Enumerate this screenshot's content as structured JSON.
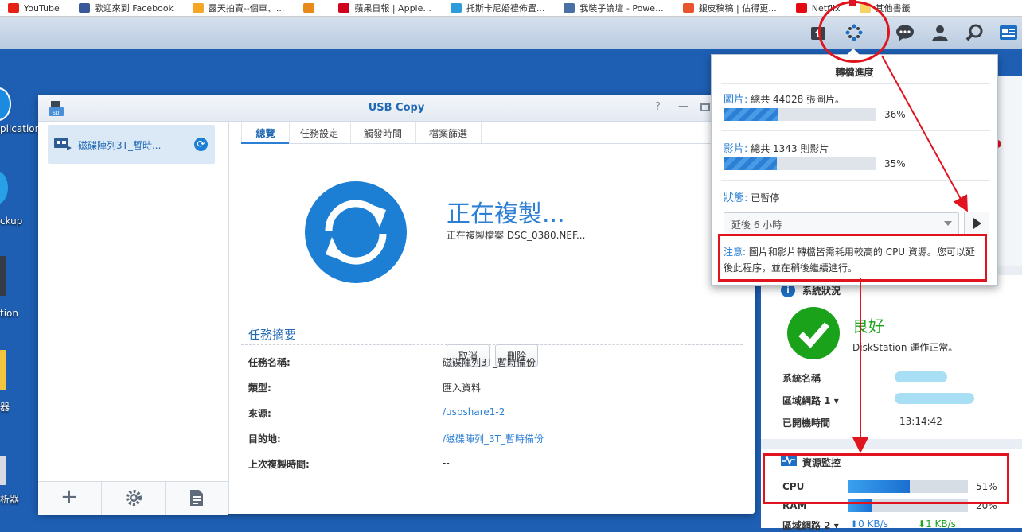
{
  "bookmarks": [
    {
      "label": "YouTube",
      "color": "#e62117"
    },
    {
      "label": "歡迎來到 Facebook",
      "color": "#3b5998"
    },
    {
      "label": "露天拍賣--個車、...",
      "color": "#f5a623"
    },
    {
      "label": "",
      "color": "#e88a1a"
    },
    {
      "label": "蘋果日報 | Apple...",
      "color": "#d0021b"
    },
    {
      "label": "托斯卡尼婚禮佈置...",
      "color": "#2d9cdb"
    },
    {
      "label": "我裝子論壇 - Powe...",
      "color": "#4a6fa5"
    },
    {
      "label": "銀皮稿稿 | 佔得更...",
      "color": "#e8542b"
    },
    {
      "label": "Netflix",
      "color": "#e50914"
    },
    {
      "label": "其他書籤",
      "color": "#f6d365"
    }
  ],
  "desktop": {
    "labels": [
      "plication",
      "ckup",
      "tion",
      "器",
      "析器"
    ]
  },
  "usb_window": {
    "title": "USB Copy",
    "help": "?",
    "minimize": "—",
    "task_item": "磁碟陣列3T_暫時...",
    "tabs": [
      "總覽",
      "任務設定",
      "觸發時間",
      "檔案篩選"
    ],
    "status_title": "正在複製...",
    "status_sub": "正在複製檔案 DSC_0380.NEF...",
    "cancel_label": "取消",
    "delete_label": "刪除",
    "summary_title": "任務摘要",
    "summary": [
      {
        "label": "任務名稱:",
        "value": "磁碟陣列3T_暫時備份",
        "link": false
      },
      {
        "label": "類型:",
        "value": "匯入資料",
        "link": false
      },
      {
        "label": "來源:",
        "value": "/usbshare1-2",
        "link": true
      },
      {
        "label": "目的地:",
        "value": "/磁碟陣列_3T_暫時備份",
        "link": true
      },
      {
        "label": "上次複製時間:",
        "value": "--",
        "link": false
      }
    ]
  },
  "popup": {
    "title": "轉檔進度",
    "photo_label": "圖片:",
    "photo_text": "總共 44028 張圖片。",
    "photo_percent": "36%",
    "photo_value": 0.36,
    "video_label": "影片:",
    "video_text": "總共 1343 則影片",
    "video_percent": "35%",
    "video_value": 0.35,
    "status_label": "狀態:",
    "status_value": "已暫停",
    "delay_select": "延後 6 小時",
    "note_label": "注意:",
    "note_text": "圖片和影片轉檔皆需耗用較高的 CPU 資源。您可以延後此程序，並在稍後繼續進行。"
  },
  "health": {
    "title": "系統狀況",
    "status": "良好",
    "desc": "DiskStation 運作正常。",
    "rows": [
      {
        "label": "系統名稱",
        "value": ""
      },
      {
        "label": "區域網路 1 ▾",
        "value": ""
      },
      {
        "label": "已開機時間",
        "value": "13:14:42"
      }
    ]
  },
  "monitor": {
    "title": "資源監控",
    "cpu_label": "CPU",
    "cpu_percent": "51%",
    "cpu_value": 0.51,
    "ram_label": "RAM",
    "ram_percent": "20%",
    "ram_value": 0.2,
    "lan_label": "區域網路 2 ▾",
    "up": "0 KB/s",
    "down": "1 KB/s"
  },
  "colors": {
    "accent": "#2b7fd4",
    "highlight": "#e0141e",
    "ok_green": "#1aa31a",
    "sync_blue": "#1c7fd4"
  }
}
